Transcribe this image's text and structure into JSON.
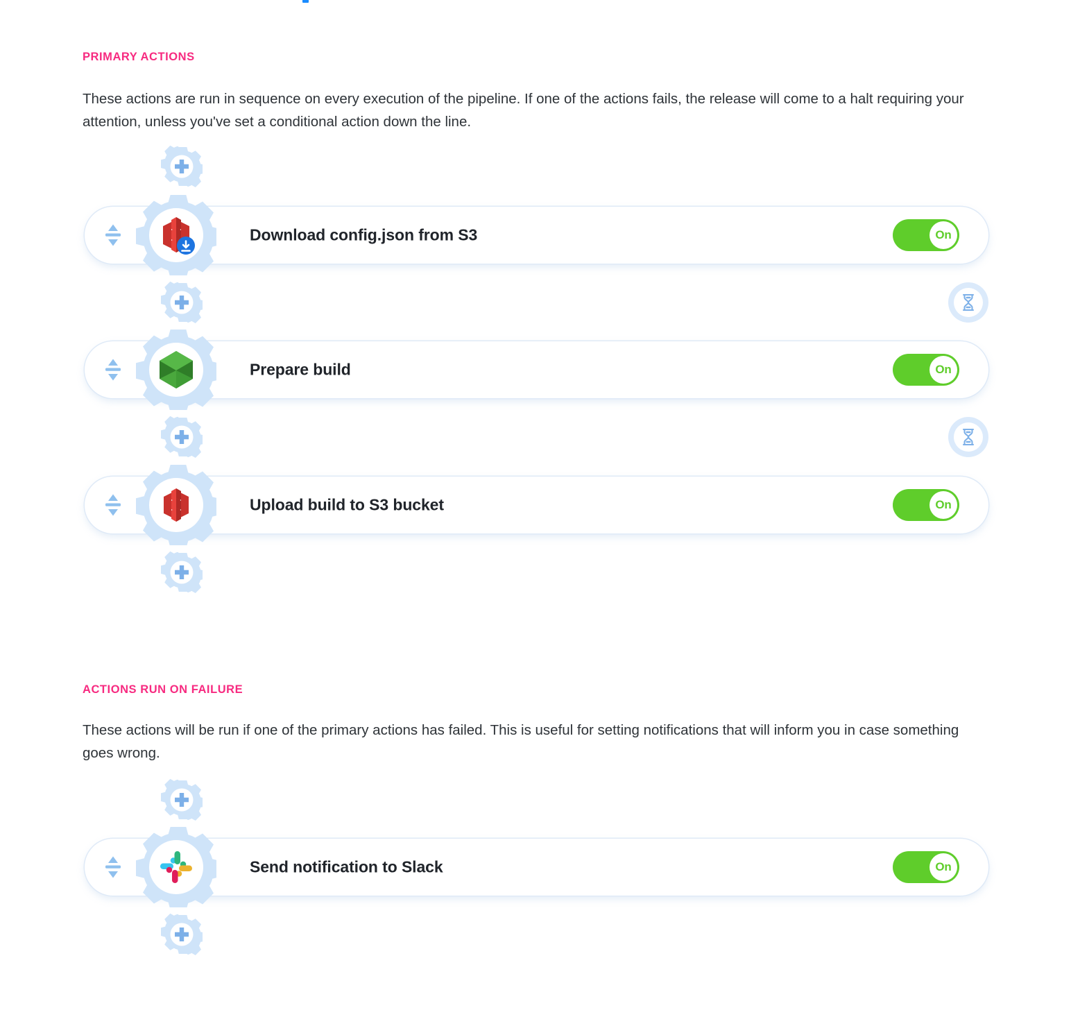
{
  "colors": {
    "heading_pink": "#f72a80",
    "toggle_green": "#5fcd2b",
    "gear_blue": "#cfe4f9",
    "body_text": "#2e3338"
  },
  "sections": [
    {
      "heading": "PRIMARY ACTIONS",
      "description": "These actions are run in sequence on every execution of the pipeline. If one of the actions fails, the release will come to a halt requiring your attention, unless you've set a conditional action down the line.",
      "actions": [
        {
          "label": "Download config.json from S3",
          "icon": "aws-s3-download-icon",
          "toggle_label": "On",
          "toggle_state": "on"
        },
        {
          "label": "Prepare build",
          "icon": "node-hexagon-icon",
          "toggle_label": "On",
          "toggle_state": "on"
        },
        {
          "label": "Upload build to S3 bucket",
          "icon": "aws-s3-icon",
          "toggle_label": "On",
          "toggle_state": "on"
        }
      ]
    },
    {
      "heading": "ACTIONS RUN ON FAILURE",
      "description": "These actions will be run if one of the primary actions has failed. This is useful for setting notifications that will inform you in case something goes wrong.",
      "actions": [
        {
          "label": "Send notification to Slack",
          "icon": "slack-icon",
          "toggle_label": "On",
          "toggle_state": "on"
        }
      ]
    }
  ],
  "icons": {
    "add_action": "plus-gear-icon",
    "wait": "hourglass-icon",
    "reorder": "drag-reorder-icon"
  }
}
